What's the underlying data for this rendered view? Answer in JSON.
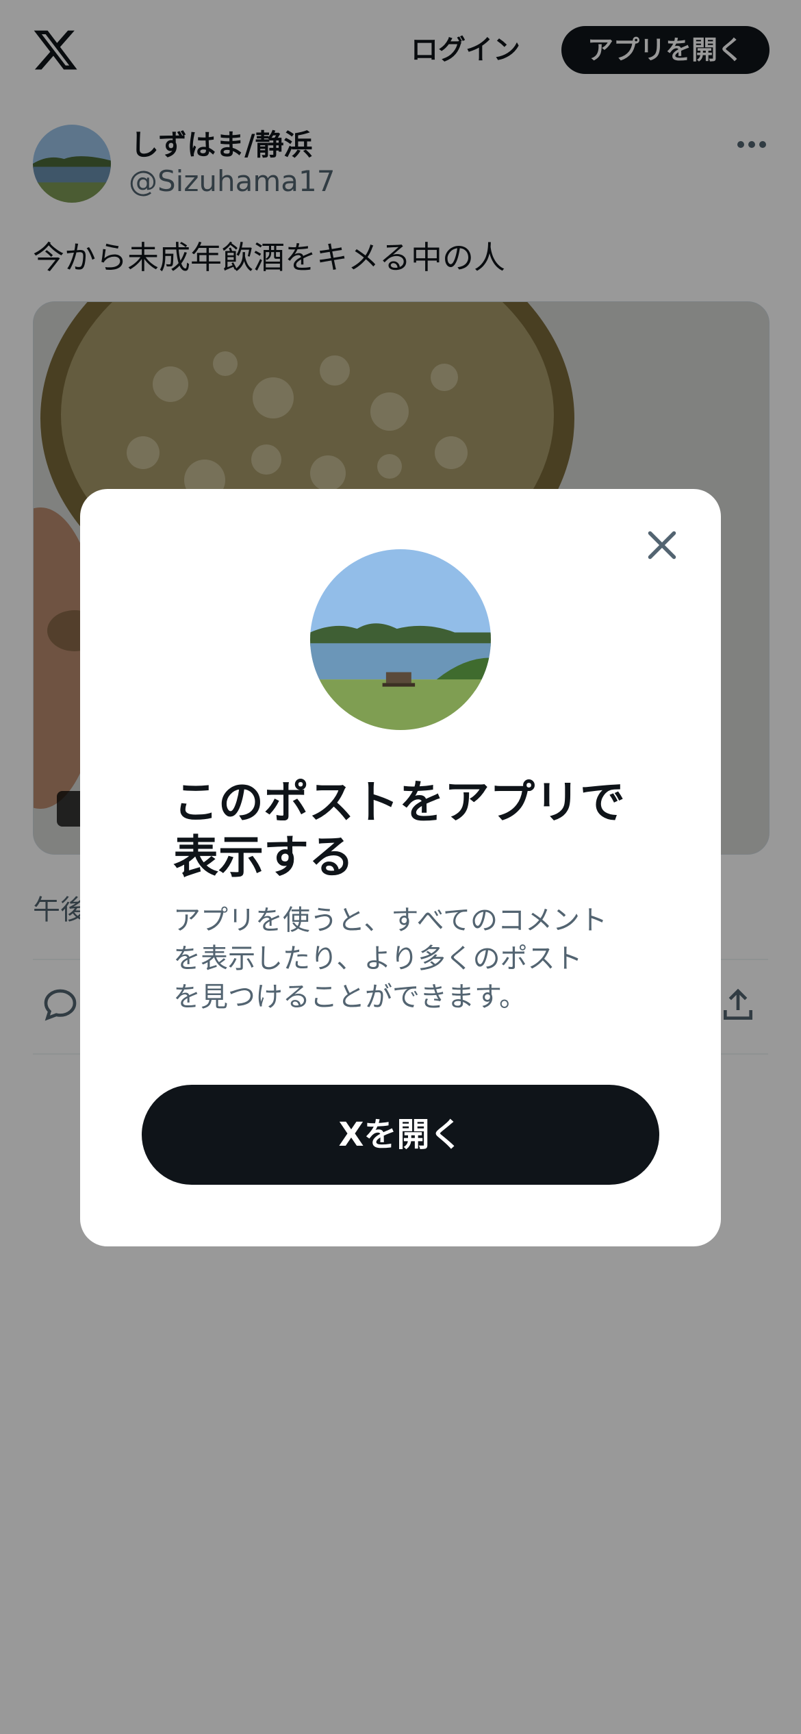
{
  "header": {
    "logo_icon": "x-logo-icon",
    "login_label": "ログイン",
    "open_app_label": "アプリを開く"
  },
  "post": {
    "author_name": "しずはま/静浜",
    "author_handle": "@Sizuhama17",
    "text": "今から未成年飲酒をキメる中の人",
    "time_partial": "午後",
    "more_icon": "more-dots-icon",
    "reply_icon": "reply-icon",
    "share_icon": "share-icon"
  },
  "modal": {
    "close_icon": "close-icon",
    "title_line1": "このポストをアプリで",
    "title_line2": "表示する",
    "desc_line1": "アプリを使うと、すべてのコメント",
    "desc_line2": "を表示したり、より多くのポスト",
    "desc_line3": "を見つけることができます。",
    "cta_label": "Xを開く"
  },
  "colors": {
    "primary_text": "#0f1419",
    "secondary_text": "#536471",
    "overlay": "rgba(0,0,0,0.4)",
    "button_bg": "#0f1419"
  }
}
